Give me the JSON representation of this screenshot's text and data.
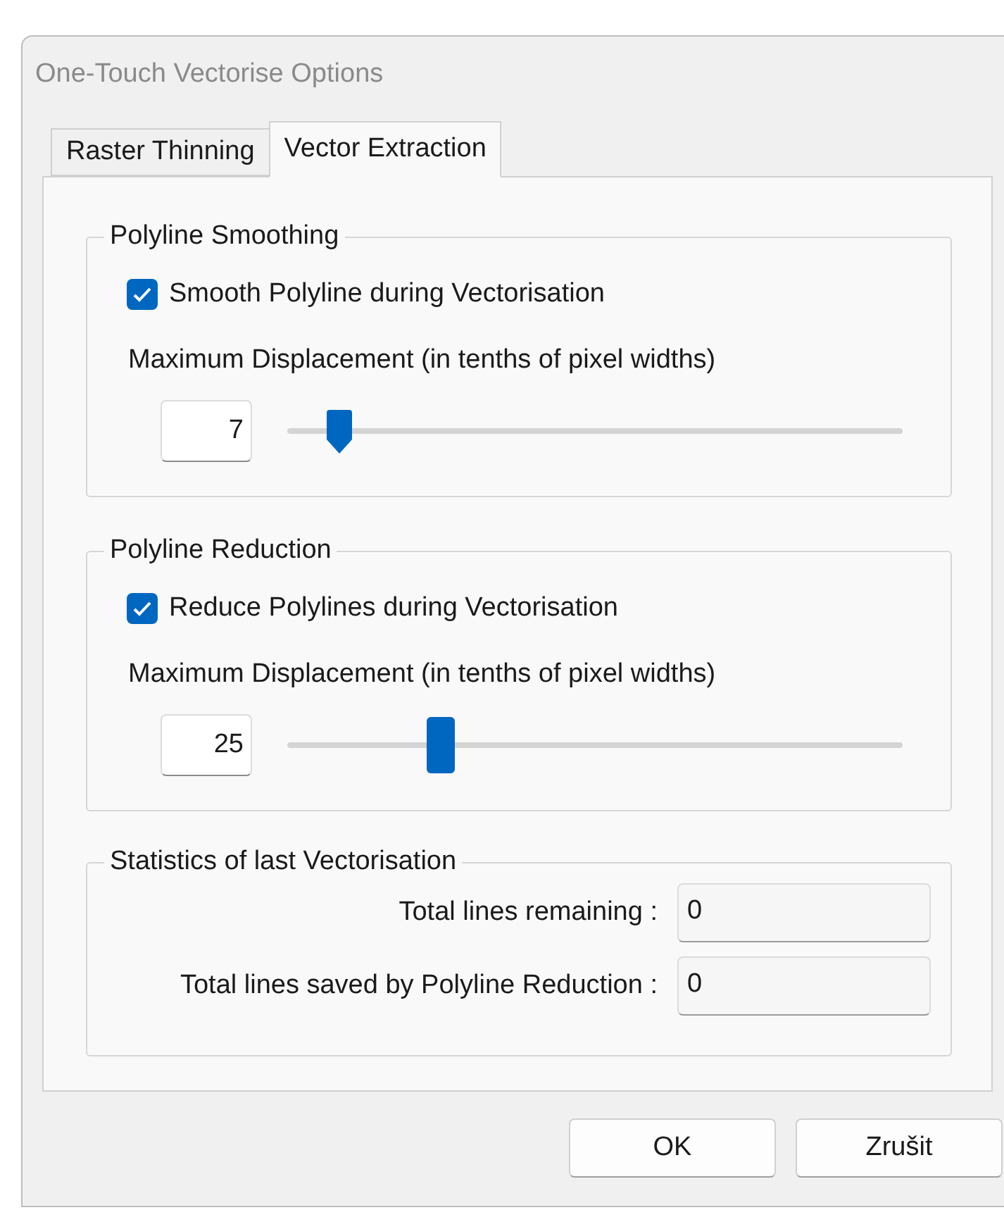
{
  "window": {
    "title": "One-Touch Vectorise Options"
  },
  "tabs": [
    {
      "label": "Raster Thinning",
      "selected": false
    },
    {
      "label": "Vector Extraction",
      "selected": true
    }
  ],
  "groups": [
    {
      "title": "Polyline Smoothing",
      "checkbox": {
        "label": "Smooth Polyline during Vectorisation",
        "checked": true
      },
      "label": "Maximum Displacement (in tenths of pixel widths)",
      "value": "7",
      "slider": {
        "level": 0.085,
        "pointer": true
      }
    },
    {
      "title": "Polyline Reduction",
      "checkbox": {
        "label": "Reduce Polylines during Vectorisation",
        "checked": true
      },
      "label": "Maximum Displacement (in tenths of pixel widths)",
      "value": "25",
      "slider": {
        "level": 0.25,
        "pointer": false
      }
    }
  ],
  "statistics": {
    "title": "Statistics of last Vectorisation",
    "rows": [
      {
        "label": "Total lines remaining :",
        "value": "0"
      },
      {
        "label": "Total lines saved by Polyline Reduction :",
        "value": "0"
      }
    ]
  },
  "buttons": [
    {
      "label": "OK"
    },
    {
      "label": "Zrušit"
    }
  ]
}
